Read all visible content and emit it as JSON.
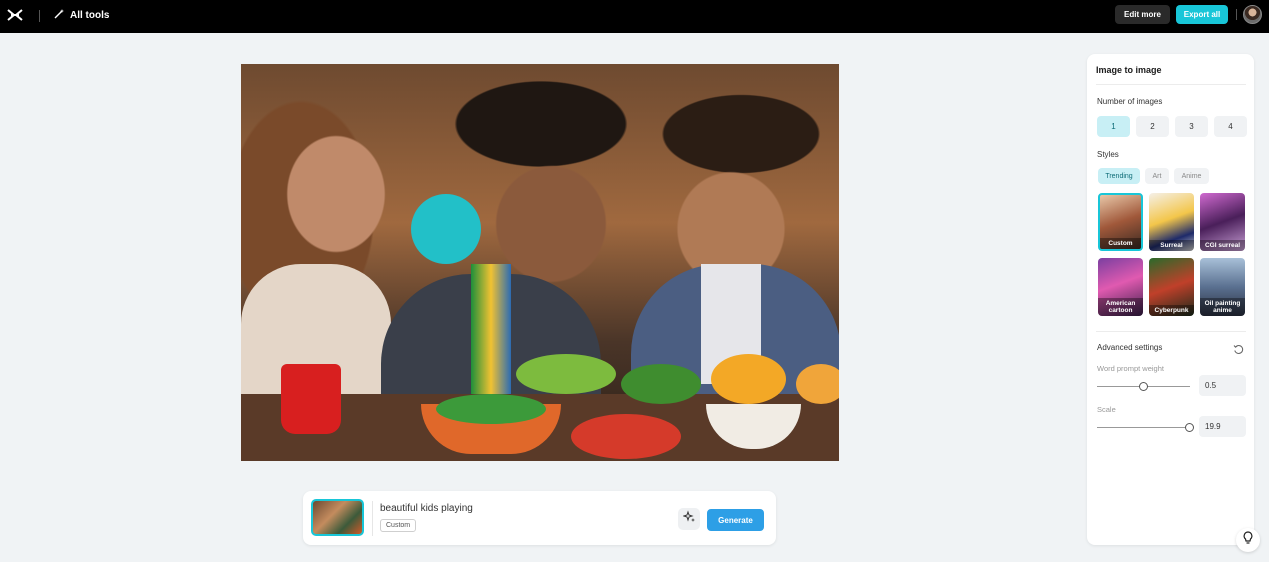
{
  "topbar": {
    "all_tools_label": "All tools",
    "edit_more_label": "Edit more",
    "export_all_label": "Export all",
    "accent_color": "#18c6d8"
  },
  "prompt_bar": {
    "prompt": "beautiful kids playing",
    "style_tag": "Custom",
    "generate_label": "Generate"
  },
  "panel": {
    "title": "Image to image",
    "number_of_images_label": "Number of images",
    "number_options": [
      "1",
      "2",
      "3",
      "4"
    ],
    "selected_number": "1",
    "styles_label": "Styles",
    "style_tabs": [
      "Trending",
      "Art",
      "Anime"
    ],
    "active_style_tab": "Trending",
    "style_cards": [
      {
        "name": "Custom",
        "selected": true
      },
      {
        "name": "Surreal",
        "selected": false
      },
      {
        "name": "CGI surreal",
        "selected": false
      },
      {
        "name": "American cartoon",
        "selected": false
      },
      {
        "name": "Cyberpunk",
        "selected": false
      },
      {
        "name": "Oil painting anime",
        "selected": false
      }
    ],
    "advanced_settings_label": "Advanced settings",
    "word_prompt_weight_label": "Word prompt weight",
    "word_prompt_weight_value": "0.5",
    "word_prompt_weight_fraction": 0.5,
    "scale_label": "Scale",
    "scale_value": "19.9",
    "scale_fraction": 1.0
  }
}
